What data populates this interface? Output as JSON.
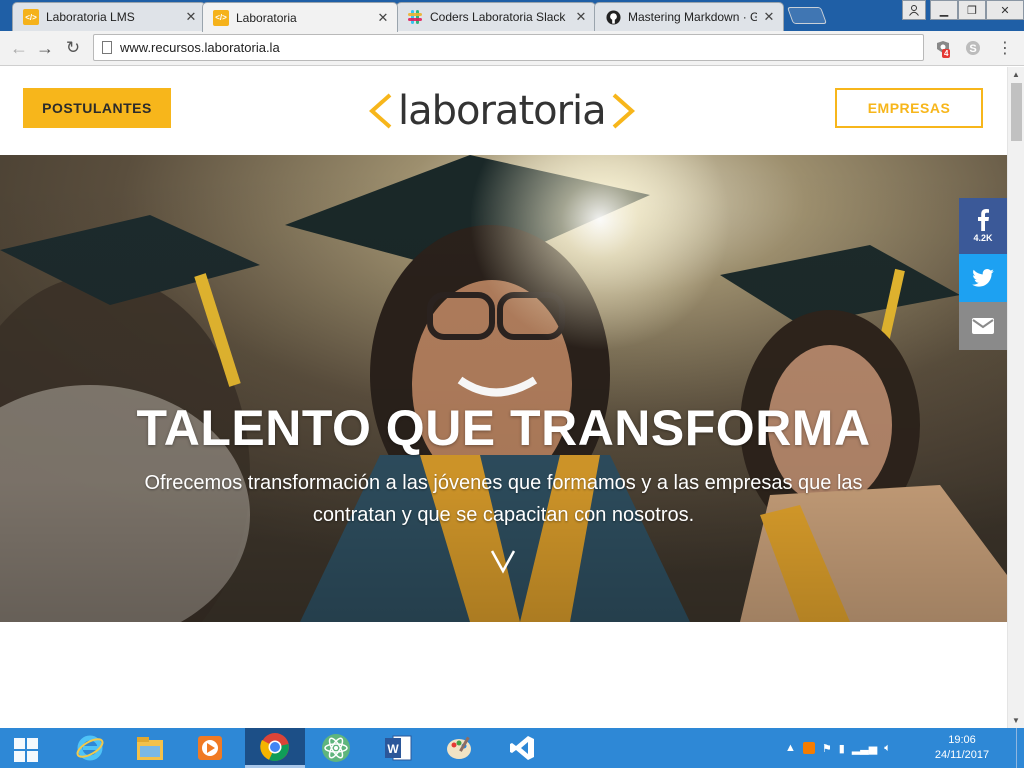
{
  "browser": {
    "tabs": [
      {
        "title": "Laboratoria LMS",
        "favicon": "laboratoria-favicon",
        "active": false
      },
      {
        "title": "Laboratoria",
        "favicon": "laboratoria-favicon",
        "active": true
      },
      {
        "title": "Coders Laboratoria Slack",
        "favicon": "slack-icon",
        "active": false
      },
      {
        "title": "Mastering Markdown · G",
        "favicon": "github-icon",
        "active": false
      }
    ],
    "url": "www.recursos.laboratoria.la",
    "extension_badge": "4",
    "favicon_text": "</>"
  },
  "site": {
    "postulantes_label": "POSTULANTES",
    "empresas_label": "EMPRESAS",
    "logo_text": "laboratoria",
    "accent_color": "#f7b61b",
    "hero": {
      "title": "TALENTO QUE TRANSFORMA",
      "subtitle": "Ofrecemos transformación a las jóvenes que formamos y a las empresas que las contratan y que se capacitan con nosotros."
    },
    "share": {
      "facebook_count": "4.2K",
      "colors": {
        "facebook": "#3b5998",
        "twitter": "#1da1f2",
        "email": "#8a8a8a"
      }
    }
  },
  "taskbar": {
    "apps": [
      "internet-explorer-icon",
      "file-explorer-icon",
      "media-player-icon",
      "chrome-icon",
      "atom-icon",
      "word-icon",
      "paint-icon",
      "vscode-icon"
    ],
    "active_app": "chrome-icon",
    "time": "19:06",
    "date": "24/11/2017"
  }
}
